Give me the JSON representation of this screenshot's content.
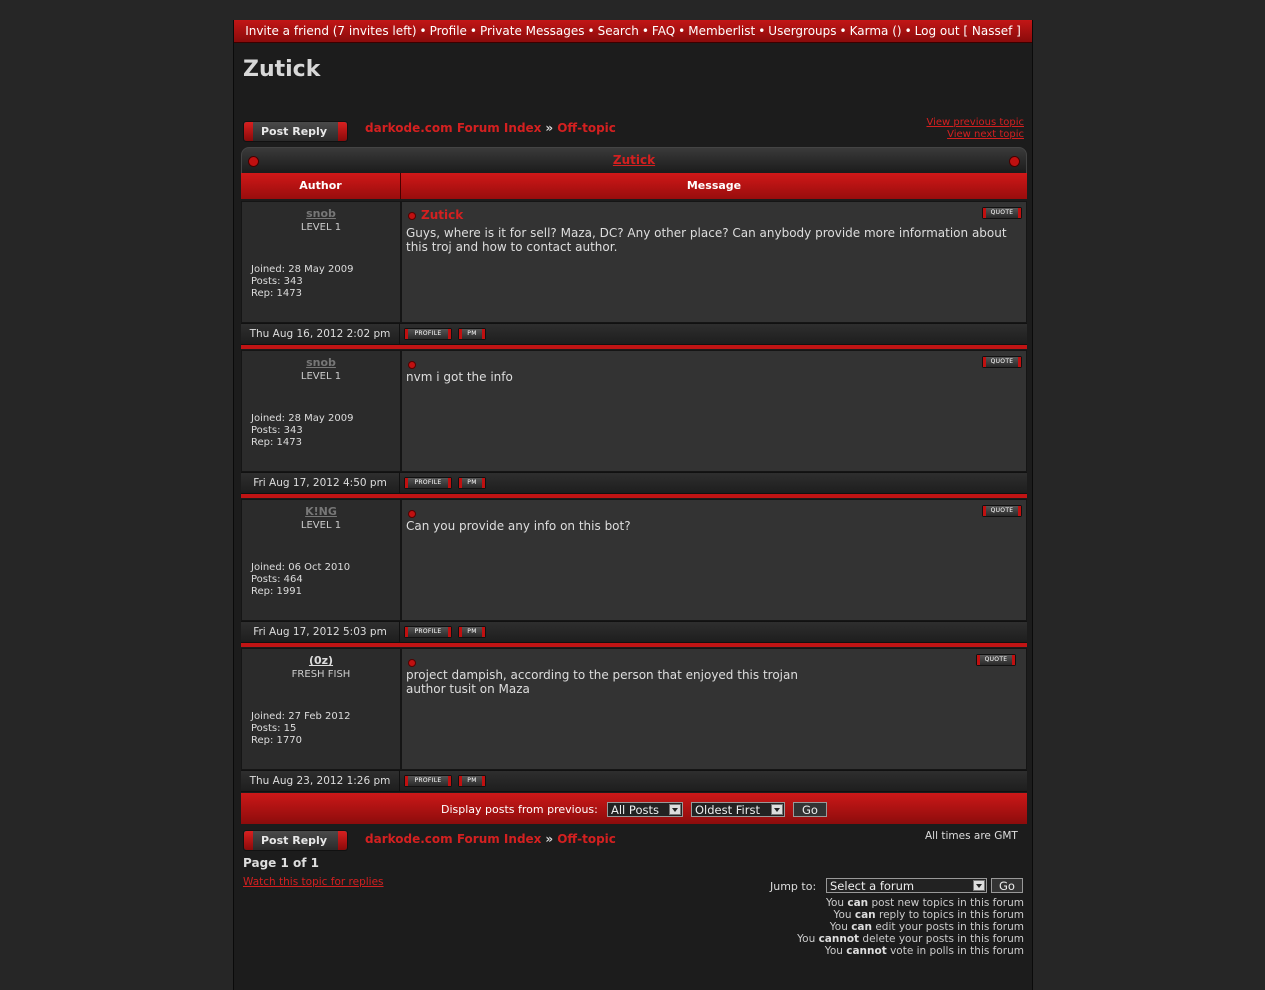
{
  "topnav": {
    "invite": "Invite a friend (7 invites left)",
    "profile": "Profile",
    "pm": "Private Messages",
    "search": "Search",
    "faq": "FAQ",
    "memberlist": "Memberlist",
    "usergroups": "Usergroups",
    "karma": "Karma ()",
    "logout": "Log out [ Nassef ]"
  },
  "page_title": "Zutick",
  "post_reply_label": "Post Reply",
  "breadcrumb": {
    "index": "darkode.com Forum Index",
    "sep": "»",
    "forum": "Off-topic"
  },
  "view_previous": "View previous topic",
  "view_next": "View next topic",
  "topic_title": "Zutick",
  "table_headers": {
    "author": "Author",
    "message": "Message"
  },
  "button_labels": {
    "quote": "QUOTE",
    "profile": "PROFILE",
    "pm": "PM"
  },
  "posts": [
    {
      "author": "snob",
      "rank": "LEVEL 1",
      "joined": "Joined: 28 May 2009",
      "posts": "Posts: 343",
      "rep": "Rep: 1473",
      "subject": "Zutick",
      "body": "Guys, where is it for sell? Maza, DC? Any other place? Can anybody provide more information about this troj and how to contact author.",
      "date": "Thu Aug 16, 2012 2:02 pm"
    },
    {
      "author": "snob",
      "rank": "LEVEL 1",
      "joined": "Joined: 28 May 2009",
      "posts": "Posts: 343",
      "rep": "Rep: 1473",
      "subject": "",
      "body": "nvm i got the info",
      "date": "Fri Aug 17, 2012 4:50 pm"
    },
    {
      "author": "K!NG",
      "rank": "LEVEL 1",
      "joined": "Joined: 06 Oct 2010",
      "posts": "Posts: 464",
      "rep": "Rep: 1991",
      "subject": "",
      "body": "Can you provide any info on this bot?",
      "date": "Fri Aug 17, 2012 5:03 pm"
    },
    {
      "author": "(0z)",
      "rank": "FRESH FISH",
      "joined": "Joined: 27 Feb 2012",
      "posts": "Posts: 15",
      "rep": "Rep: 1770",
      "subject": "",
      "body": "project dampish, according to the person that enjoyed this trojan\nauthor tusit on Maza",
      "date": "Thu Aug 23, 2012 1:26 pm"
    }
  ],
  "filter": {
    "label": "Display posts from previous:",
    "period": "All Posts",
    "order": "Oldest First",
    "go": "Go"
  },
  "timezone": "All times are GMT",
  "page_of": "Page 1 of 1",
  "watch": "Watch this topic for replies",
  "jump": {
    "label": "Jump to:",
    "value": "Select a forum",
    "go": "Go"
  },
  "perms": {
    "l1a": "You ",
    "l1b": "can",
    "l1c": " post new topics in this forum",
    "l2a": "You ",
    "l2b": "can",
    "l2c": " reply to topics in this forum",
    "l3a": "You ",
    "l3b": "can",
    "l3c": " edit your posts in this forum",
    "l4a": "You ",
    "l4b": "cannot",
    "l4c": " delete your posts in this forum",
    "l5a": "You ",
    "l5b": "cannot",
    "l5c": " vote in polls in this forum"
  }
}
